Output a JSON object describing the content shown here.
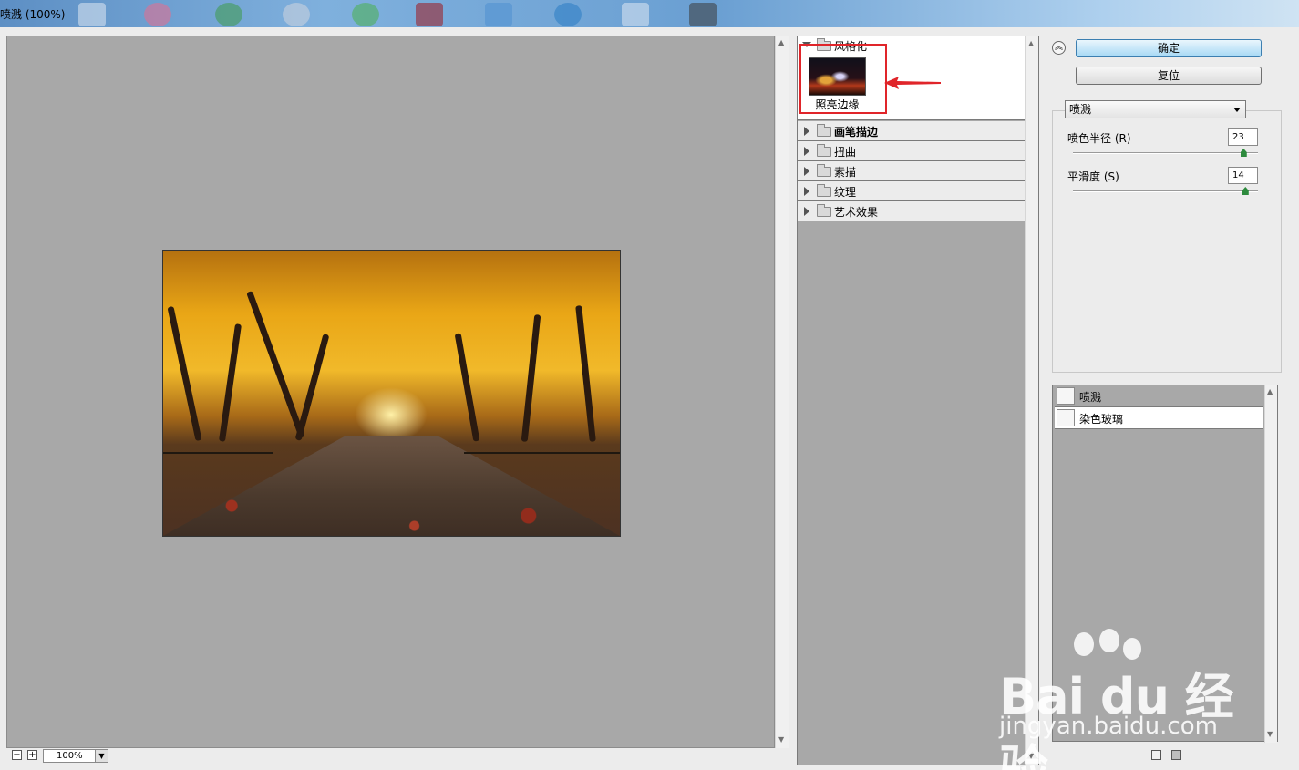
{
  "window": {
    "title": "喷溅 (100%)"
  },
  "zoom": {
    "value": "100%",
    "minus": "−",
    "plus": "+"
  },
  "filter_gallery": {
    "thumbnail_label": "照亮边缘",
    "categories": [
      {
        "label": "风格化",
        "expanded": true
      },
      {
        "label": "画笔描边",
        "expanded": false,
        "bold": true
      },
      {
        "label": "扭曲",
        "expanded": false
      },
      {
        "label": "素描",
        "expanded": false
      },
      {
        "label": "纹理",
        "expanded": false
      },
      {
        "label": "艺术效果",
        "expanded": false
      }
    ]
  },
  "buttons": {
    "ok": "确定",
    "reset": "复位"
  },
  "filter_select": {
    "value": "喷溅"
  },
  "params": [
    {
      "label": "喷色半径 (R)",
      "value": "23",
      "fraction": 0.92
    },
    {
      "label": "平滑度 (S)",
      "value": "14",
      "fraction": 0.93
    }
  ],
  "layers": [
    {
      "label": "喷溅"
    },
    {
      "label": "染色玻璃"
    }
  ],
  "watermark": {
    "brand": "Bai du 经验",
    "url": "jingyan.baidu.com"
  }
}
